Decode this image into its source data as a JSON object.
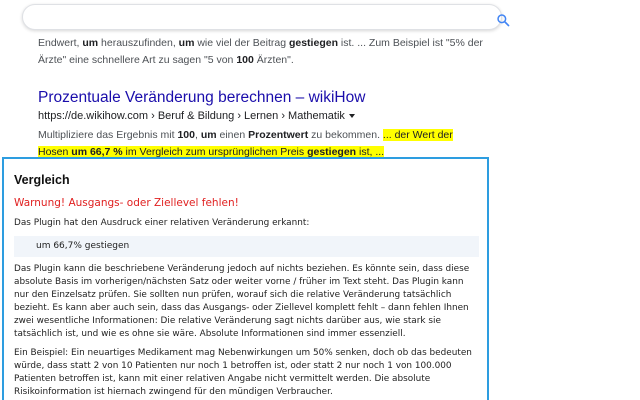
{
  "search": {
    "value": "",
    "icon": "search-icon",
    "accent": "#4285f4"
  },
  "results": {
    "prev_snippet": {
      "line1_parts": [
        {
          "t": "Endwert, ",
          "b": false
        },
        {
          "t": "um",
          "b": true
        },
        {
          "t": " herauszufinden, ",
          "b": false
        },
        {
          "t": "um",
          "b": true
        },
        {
          "t": " wie viel der Beitrag ",
          "b": false
        },
        {
          "t": "gestiegen",
          "b": true
        },
        {
          "t": " ist. ... Zum Beispiel ist \"5% der",
          "b": false
        }
      ],
      "line2_parts": [
        {
          "t": "Ärzte\" eine schnellere Art zu sagen \"5 von ",
          "b": false
        },
        {
          "t": "100",
          "b": true
        },
        {
          "t": " Ärzten\".",
          "b": false
        }
      ]
    },
    "item": {
      "title": "Prozentuale Veränderung berechnen – wikiHow",
      "breadcrumb": "https://de.wikihow.com › Beruf & Bildung › Lernen › Mathematik",
      "line1_parts": [
        {
          "t": "Multipliziere das Ergebnis mit ",
          "b": false,
          "h": false
        },
        {
          "t": "100",
          "b": true,
          "h": false
        },
        {
          "t": ", ",
          "b": false,
          "h": false
        },
        {
          "t": "um",
          "b": true,
          "h": false
        },
        {
          "t": " einen ",
          "b": false,
          "h": false
        },
        {
          "t": "Prozentwert",
          "b": true,
          "h": false
        },
        {
          "t": " zu bekommen. ",
          "b": false,
          "h": false
        },
        {
          "t": "... der Wert der",
          "b": false,
          "h": true
        }
      ],
      "line2_parts": [
        {
          "t": "Hosen ",
          "b": false,
          "h": true
        },
        {
          "t": "um 66,7 %",
          "b": true,
          "h": true
        },
        {
          "t": " im Vergleich zum ursprünglichen Preis ",
          "b": false,
          "h": true
        },
        {
          "t": "gestiegen",
          "b": true,
          "h": true
        },
        {
          "t": " ist, ...",
          "b": false,
          "h": true
        }
      ]
    }
  },
  "popup": {
    "title": "Vergleich",
    "warning": "Warnung! Ausgangs- oder Ziellevel fehlen!",
    "detected_text": "Das Plugin hat den Ausdruck einer relativen Veränderung erkannt:",
    "expression": "um 66,7% gestiegen",
    "paragraph1": "Das Plugin kann die beschriebene Veränderung jedoch auf nichts beziehen. Es könnte sein, dass diese absolute Basis im vorherigen/nächsten Satz oder weiter vorne / früher im Text steht. Das Plugin kann nur den Einzelsatz prüfen. Sie sollten nun prüfen, worauf sich die relative Veränderung tatsächlich bezieht. Es kann aber auch sein, dass das Ausgangs- oder Ziellevel komplett fehlt – dann fehlen Ihnen zwei wesentliche Informationen: Die relative Veränderung sagt nichts darüber aus, wie stark sie tatsächlich ist, und wie es ohne sie wäre. Absolute Informationen sind immer essenziell.",
    "paragraph2": "Ein Beispiel: Ein neuartiges Medikament mag Nebenwirkungen um 50% senken, doch ob das bedeuten würde, dass statt 2 von 10 Patienten nur noch 1 betroffen ist, oder statt 2 nur noch 1 von 100.000 Patienten betroffen ist, kann mit einer relativen Angabe nicht vermittelt werden. Die absolute Risikoinformation ist hiernach zwingend für den mündigen Verbraucher.",
    "border_color": "#2d9de0",
    "warning_color": "#e02020"
  },
  "colors": {
    "link": "#1a0dab",
    "highlight": "#ffff00"
  }
}
